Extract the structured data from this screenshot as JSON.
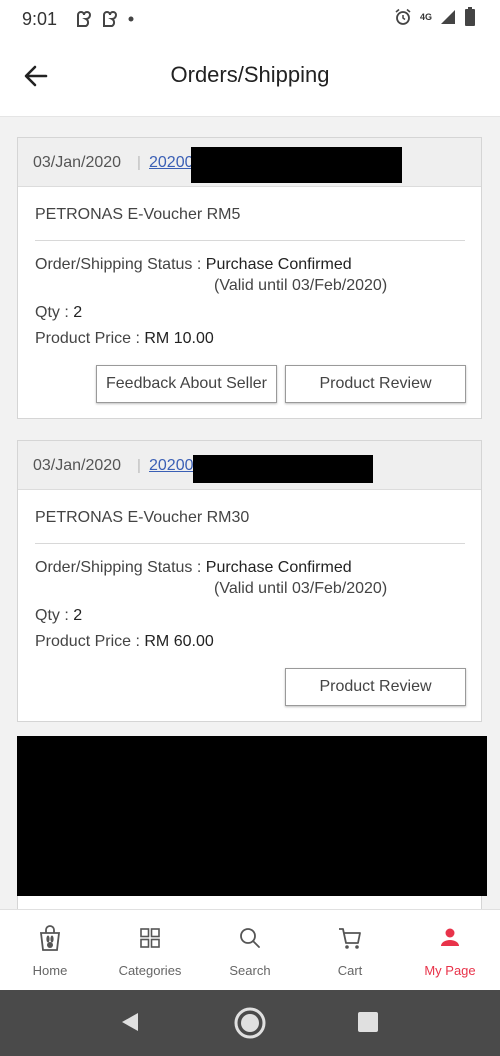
{
  "status_bar": {
    "time": "9:01",
    "network": "4G",
    "battery": "90"
  },
  "header": {
    "title": "Orders/Shipping"
  },
  "orders": [
    {
      "date": "03/Jan/2020",
      "order_no_prefix": "20200",
      "product": "PETRONAS E-Voucher RM5",
      "status_label": "Order/Shipping Status : ",
      "status_value": "Purchase Confirmed",
      "valid_until": "(Valid until 03/Feb/2020)",
      "qty_label": "Qty : ",
      "qty": "2",
      "price_label": "Product Price : ",
      "price": "RM 10.00",
      "buttons": {
        "feedback": "Feedback About Seller",
        "review": "Product Review"
      }
    },
    {
      "date": "03/Jan/2020",
      "order_no_prefix": "20200",
      "product": "PETRONAS E-Voucher RM30",
      "status_label": "Order/Shipping Status : ",
      "status_value": "Purchase Confirmed",
      "valid_until": "(Valid until 03/Feb/2020)",
      "qty_label": "Qty : ",
      "qty": "2",
      "price_label": "Product Price : ",
      "price": "RM 60.00",
      "buttons": {
        "review": "Product Review"
      }
    }
  ],
  "bottom_nav": {
    "items": [
      {
        "label": "Home",
        "icon": "shopping-bag-icon"
      },
      {
        "label": "Categories",
        "icon": "grid-icon"
      },
      {
        "label": "Search",
        "icon": "search-icon"
      },
      {
        "label": "Cart",
        "icon": "cart-icon"
      },
      {
        "label": "My Page",
        "icon": "person-icon"
      }
    ],
    "active": "My Page"
  },
  "colors": {
    "accent": "#e8334a",
    "link": "#3a5fb5"
  }
}
